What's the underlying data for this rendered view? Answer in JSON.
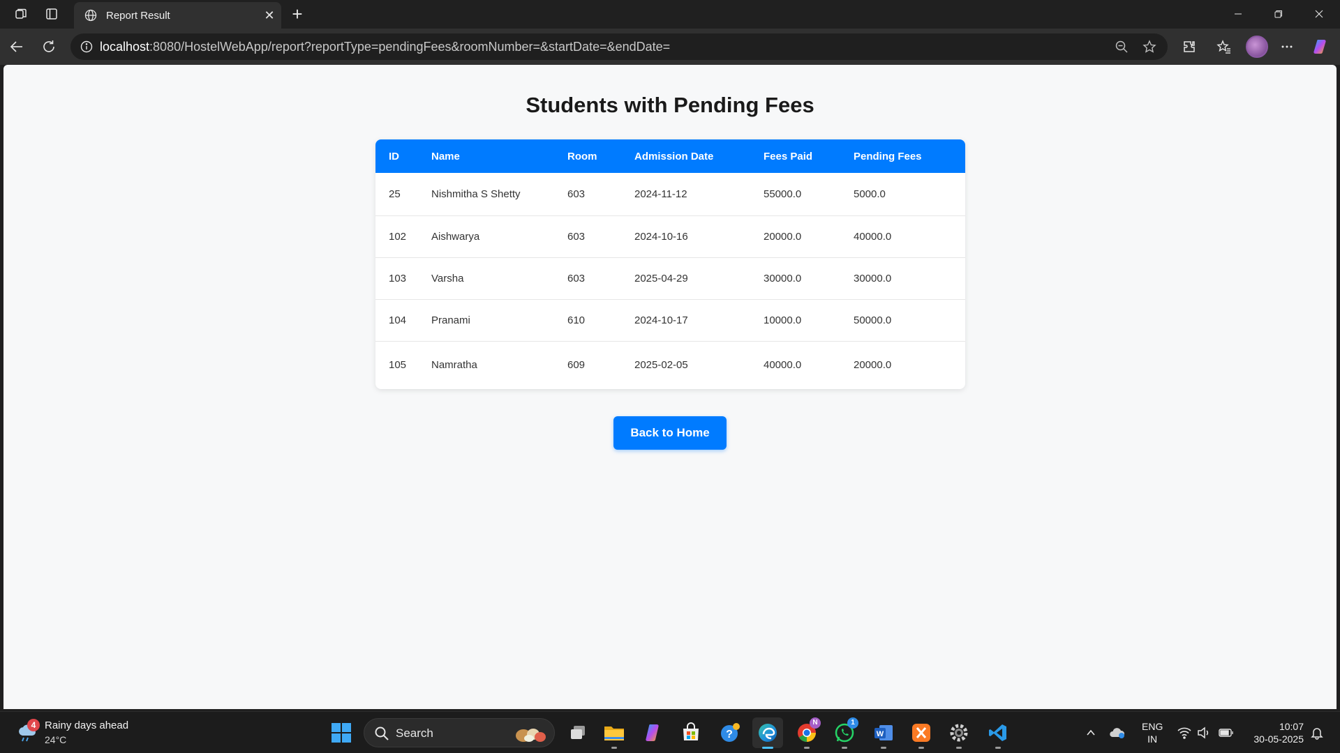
{
  "browser": {
    "tab_title": "Report Result",
    "url_host": "localhost",
    "url_rest": ":8080/HostelWebApp/report?reportType=pendingFees&roomNumber=&startDate=&endDate="
  },
  "page": {
    "title": "Students with Pending Fees",
    "columns": [
      "ID",
      "Name",
      "Room",
      "Admission Date",
      "Fees Paid",
      "Pending Fees"
    ],
    "rows": [
      [
        "25",
        "Nishmitha S Shetty",
        "603",
        "2024-11-12",
        "55000.0",
        "5000.0"
      ],
      [
        "102",
        "Aishwarya",
        "603",
        "2024-10-16",
        "20000.0",
        "40000.0"
      ],
      [
        "103",
        "Varsha",
        "603",
        "2025-04-29",
        "30000.0",
        "30000.0"
      ],
      [
        "104",
        "Pranami",
        "610",
        "2024-10-17",
        "10000.0",
        "50000.0"
      ],
      [
        "105",
        "Namratha",
        "609",
        "2025-02-05",
        "40000.0",
        "20000.0"
      ]
    ],
    "back_button": "Back to Home"
  },
  "taskbar": {
    "weather_badge": "4",
    "weather_text": "Rainy days ahead",
    "weather_temp": "24°C",
    "search_label": "Search",
    "chrome_badge": "N",
    "whatsapp_badge": "1",
    "lang_1": "ENG",
    "lang_2": "IN",
    "time": "10:07",
    "date": "30-05-2025"
  },
  "colors": {
    "accent": "#007bff",
    "header_text": "#ffffff",
    "page_bg": "#f7f8f9"
  },
  "icons": [
    "workspaces-icon",
    "tab-actions-icon",
    "globe-icon",
    "close-icon",
    "plus-icon",
    "minimize-icon",
    "restore-icon",
    "back-icon",
    "refresh-icon",
    "info-icon",
    "zoom-icon",
    "favorite-star-icon",
    "extensions-icon",
    "favorites-icon",
    "more-icon",
    "copilot-icon"
  ]
}
